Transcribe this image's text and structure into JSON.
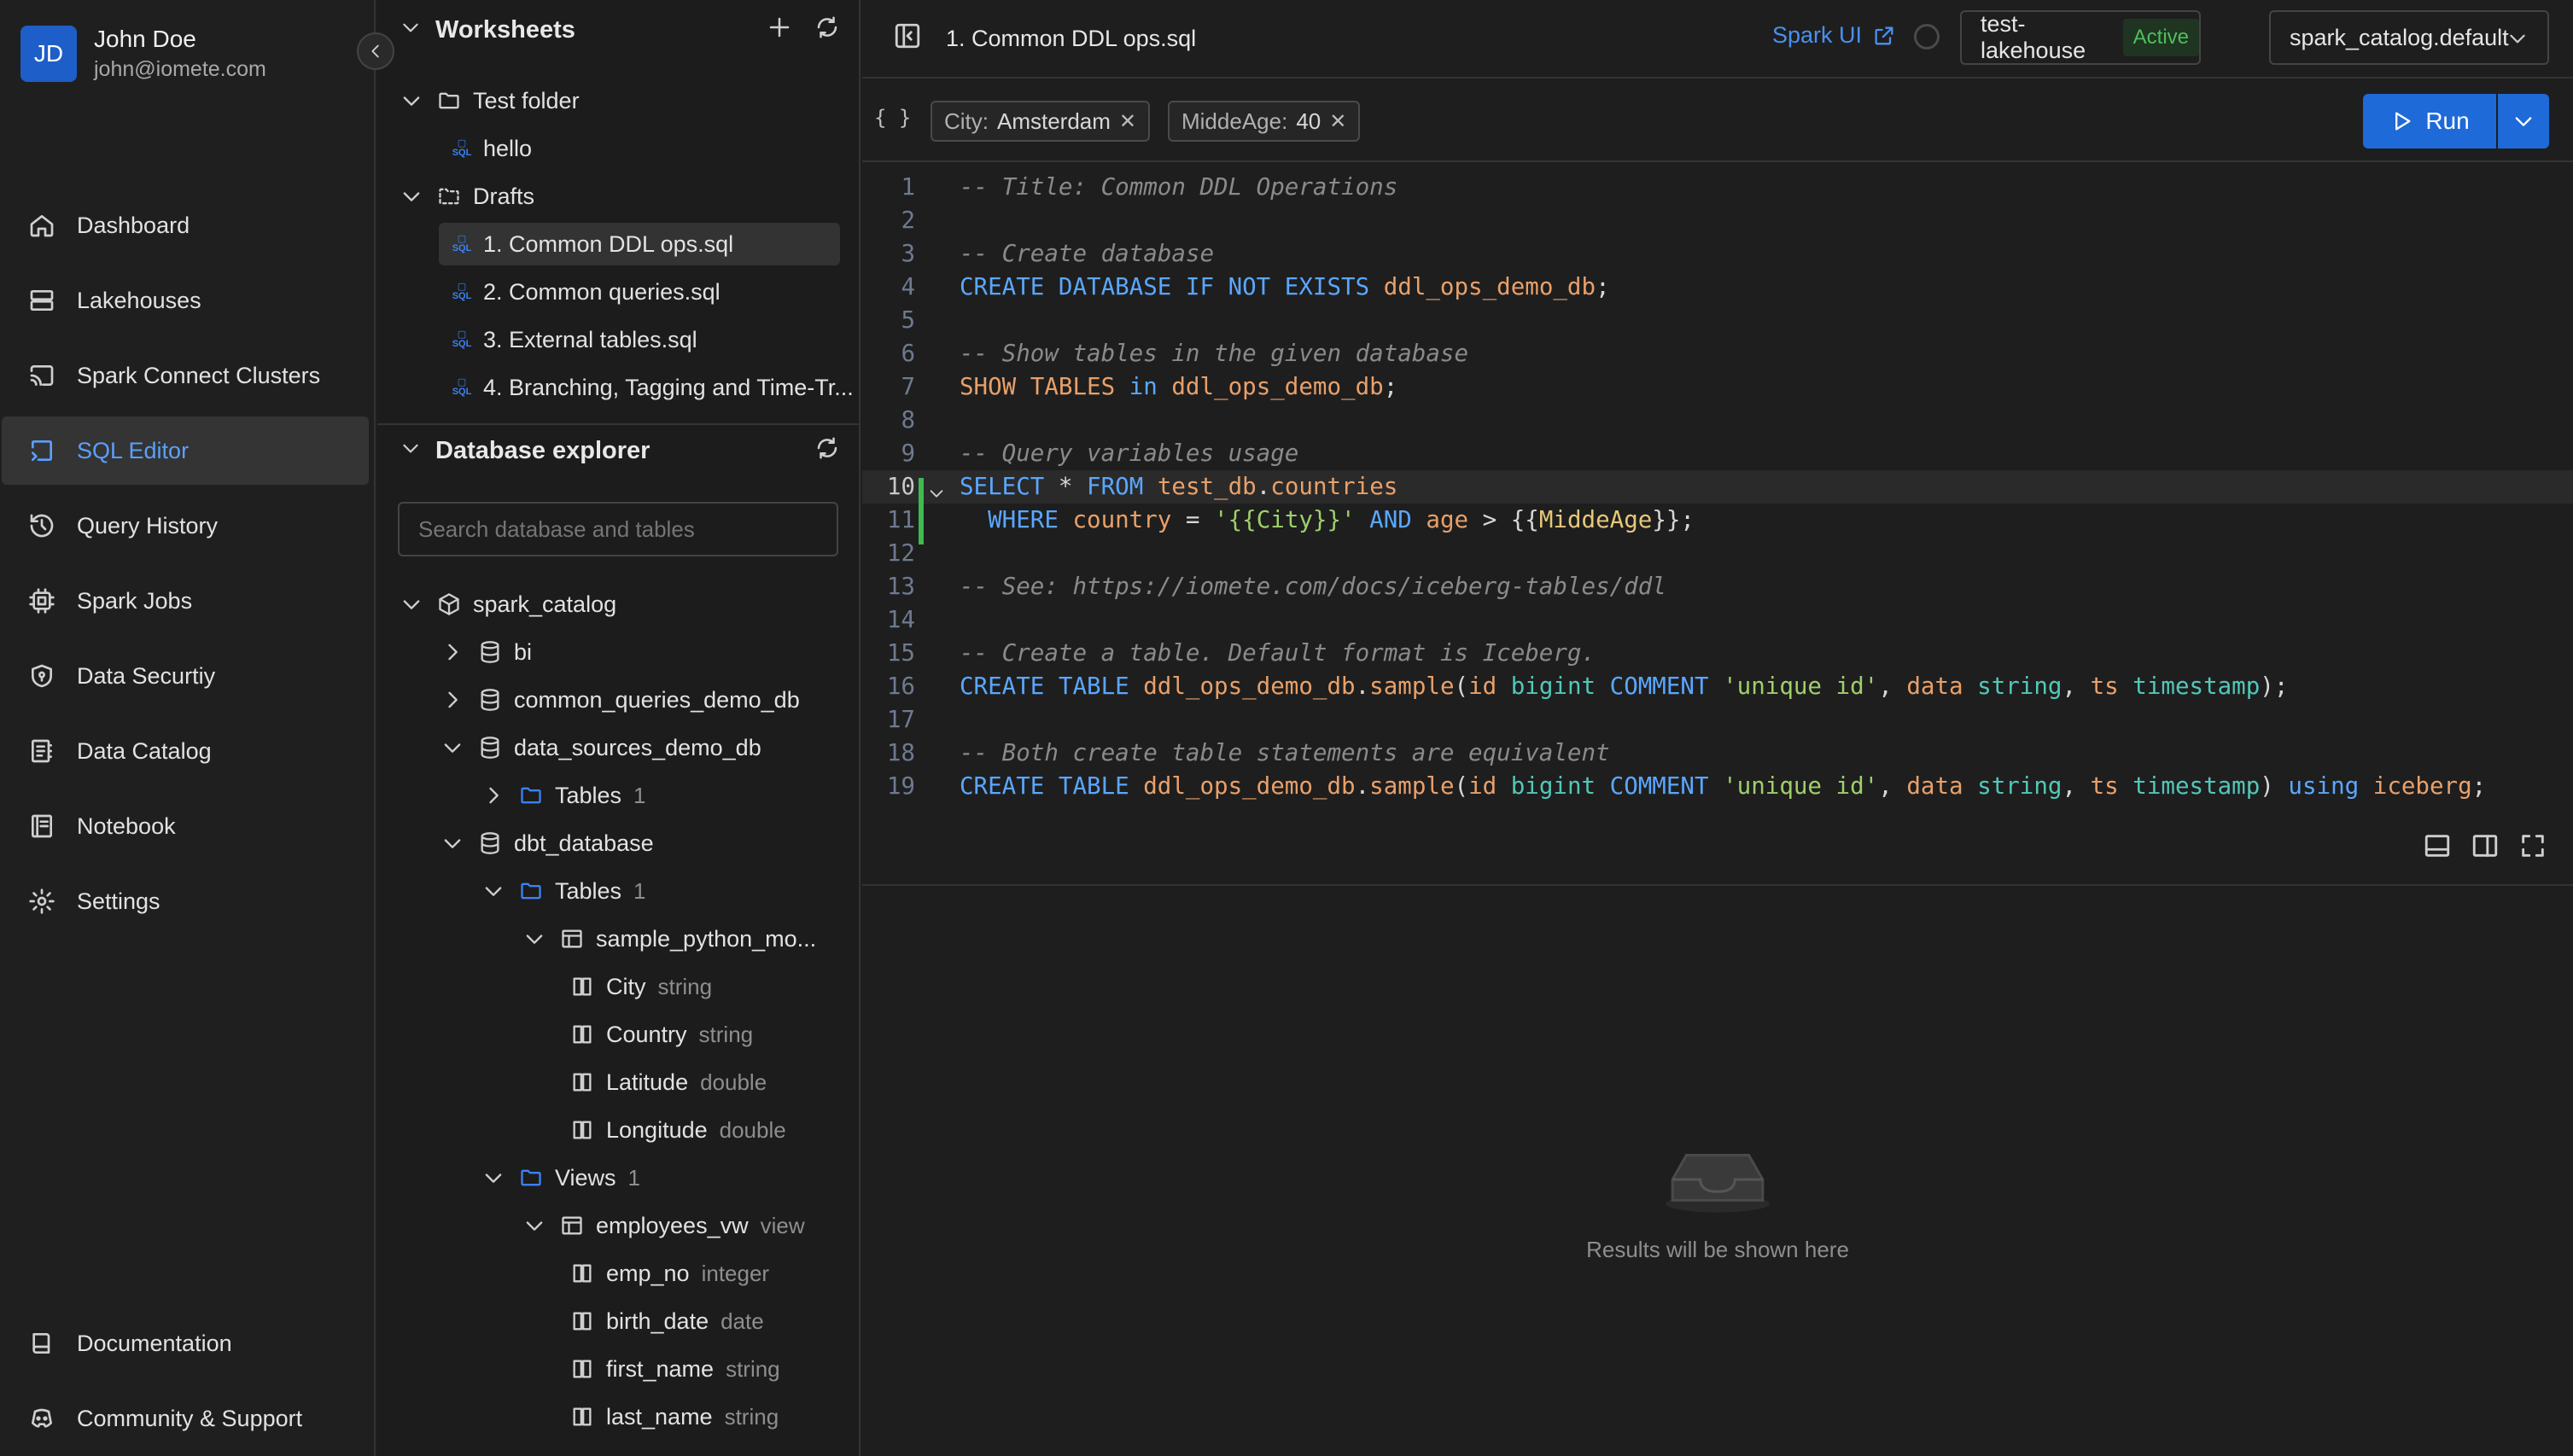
{
  "user": {
    "initials": "JD",
    "name": "John Doe",
    "email": "john@iomete.com"
  },
  "nav": {
    "items": [
      {
        "label": "Dashboard",
        "icon": "home-icon"
      },
      {
        "label": "Lakehouses",
        "icon": "server-icon"
      },
      {
        "label": "Spark Connect Clusters",
        "icon": "cast-icon"
      },
      {
        "label": "SQL Editor",
        "icon": "sql-editor-icon",
        "active": true
      },
      {
        "label": "Query History",
        "icon": "history-icon"
      },
      {
        "label": "Spark Jobs",
        "icon": "cpu-icon"
      },
      {
        "label": "Data Securtiy",
        "icon": "shield-icon"
      },
      {
        "label": "Data Catalog",
        "icon": "catalog-icon"
      },
      {
        "label": "Notebook",
        "icon": "notebook-icon"
      },
      {
        "label": "Settings",
        "icon": "gear-icon"
      }
    ],
    "bottom": [
      {
        "label": "Documentation",
        "icon": "book-icon"
      },
      {
        "label": "Community & Support",
        "icon": "discord-icon"
      }
    ]
  },
  "worksheets": {
    "title": "Worksheets",
    "test_folder": "Test folder",
    "hello": "hello",
    "drafts": "Drafts",
    "files": [
      "1. Common DDL ops.sql",
      "2. Common queries.sql",
      "3. External tables.sql",
      "4. Branching, Tagging and Time-Tr..."
    ]
  },
  "explorer": {
    "title": "Database explorer",
    "search_placeholder": "Search database and tables",
    "catalog": "spark_catalog",
    "dbs": [
      "bi",
      "common_queries_demo_db",
      "data_sources_demo_db",
      "dbt_database"
    ],
    "tables_label": "Tables",
    "tables_count_1": "1",
    "tables_count_2": "1",
    "table_name": "sample_python_mo...",
    "table_cols": [
      {
        "name": "City",
        "type": "string"
      },
      {
        "name": "Country",
        "type": "string"
      },
      {
        "name": "Latitude",
        "type": "double"
      },
      {
        "name": "Longitude",
        "type": "double"
      }
    ],
    "views_label": "Views",
    "views_count": "1",
    "view_name": "employees_vw",
    "view_tag": "view",
    "view_cols": [
      {
        "name": "emp_no",
        "type": "integer"
      },
      {
        "name": "birth_date",
        "type": "date"
      },
      {
        "name": "first_name",
        "type": "string"
      },
      {
        "name": "last_name",
        "type": "string"
      }
    ]
  },
  "editor": {
    "file_title": "1. Common DDL ops.sql",
    "spark_ui": "Spark UI",
    "lakehouse": "test-lakehouse",
    "lakehouse_status": "Active",
    "catalog": "spark_catalog.default",
    "run_label": "Run",
    "braces": "{ }",
    "variables": [
      {
        "key": "City:",
        "value": "Amsterdam"
      },
      {
        "key": "MiddeAge:",
        "value": "40"
      }
    ],
    "lines": [
      [
        [
          "cm",
          "-- Title: Common DDL Operations"
        ]
      ],
      [],
      [
        [
          "cm",
          "-- Create database"
        ]
      ],
      [
        [
          "kw",
          "CREATE DATABASE IF NOT EXISTS "
        ],
        [
          "id",
          "ddl_ops_demo_db"
        ],
        [
          "pl",
          ";"
        ]
      ],
      [],
      [
        [
          "cm",
          "-- Show tables in the given database"
        ]
      ],
      [
        [
          "id",
          "SHOW TABLES "
        ],
        [
          "kw",
          "in "
        ],
        [
          "id",
          "ddl_ops_demo_db"
        ],
        [
          "pl",
          ";"
        ]
      ],
      [],
      [
        [
          "cm",
          "-- Query variables usage"
        ]
      ],
      [
        [
          "kw",
          "SELECT "
        ],
        [
          "pl",
          "* "
        ],
        [
          "kw",
          "FROM "
        ],
        [
          "id",
          "test_db"
        ],
        [
          "pl",
          "."
        ],
        [
          "id",
          "countries"
        ]
      ],
      [
        [
          "kw",
          "  WHERE "
        ],
        [
          "id",
          "country "
        ],
        [
          "pl",
          "= "
        ],
        [
          "str",
          "'{{City}}' "
        ],
        [
          "kw",
          "AND "
        ],
        [
          "id",
          "age "
        ],
        [
          "pl",
          "> {{"
        ],
        [
          "vr",
          "MiddeAge"
        ],
        [
          "pl",
          "}};"
        ]
      ],
      [],
      [
        [
          "cm",
          "-- See: https://iomete.com/docs/iceberg-tables/ddl"
        ]
      ],
      [],
      [
        [
          "cm",
          "-- Create a table. Default format is Iceberg."
        ]
      ],
      [
        [
          "kw",
          "CREATE TABLE "
        ],
        [
          "id",
          "ddl_ops_demo_db"
        ],
        [
          "pl",
          "."
        ],
        [
          "id",
          "sample"
        ],
        [
          "pl",
          "("
        ],
        [
          "id",
          "id "
        ],
        [
          "ty",
          "bigint "
        ],
        [
          "kw",
          "COMMENT "
        ],
        [
          "str",
          "'unique id'"
        ],
        [
          "pl",
          ", "
        ],
        [
          "id",
          "data "
        ],
        [
          "ty",
          "string"
        ],
        [
          "pl",
          ", "
        ],
        [
          "id",
          "ts "
        ],
        [
          "ty",
          "timestamp"
        ],
        [
          "pl",
          ");"
        ]
      ],
      [],
      [
        [
          "cm",
          "-- Both create table statements are equivalent"
        ]
      ],
      [
        [
          "kw",
          "CREATE TABLE "
        ],
        [
          "id",
          "ddl_ops_demo_db"
        ],
        [
          "pl",
          "."
        ],
        [
          "id",
          "sample"
        ],
        [
          "pl",
          "("
        ],
        [
          "id",
          "id "
        ],
        [
          "ty",
          "bigint "
        ],
        [
          "kw",
          "COMMENT "
        ],
        [
          "str",
          "'unique id'"
        ],
        [
          "pl",
          ", "
        ],
        [
          "id",
          "data "
        ],
        [
          "ty",
          "string"
        ],
        [
          "pl",
          ", "
        ],
        [
          "id",
          "ts "
        ],
        [
          "ty",
          "timestamp"
        ],
        [
          "pl",
          ") "
        ],
        [
          "kw",
          "using "
        ],
        [
          "id",
          "iceberg"
        ],
        [
          "pl",
          ";"
        ]
      ]
    ],
    "current_line": 10
  },
  "results": {
    "empty_text": "Results will be shown here"
  }
}
